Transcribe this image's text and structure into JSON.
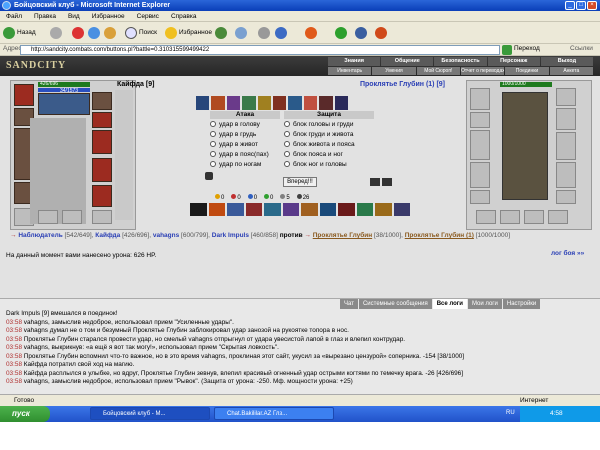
{
  "window": {
    "title": "Бойцовский клуб - Microsoft Internet Explorer"
  },
  "menu": [
    "Файл",
    "Правка",
    "Вид",
    "Избранное",
    "Сервис",
    "Справка"
  ],
  "toolbar": {
    "back": "Назад",
    "search": "Поиск",
    "favorites": "Избранное"
  },
  "address": {
    "label": "Адрес",
    "url": "http://sandcity.combats.com/buttons.pl?battle=0.310315599499422",
    "go": "Переход",
    "links": "Ссылки"
  },
  "site": {
    "logo": "SANDCITY",
    "nav": [
      "Знания",
      "Общение",
      "Безопасность",
      "Персонаж",
      "Выход"
    ],
    "subnav": [
      "Инвентарь",
      "Умения",
      "Мой Сюроп!",
      "Отчет о переводах",
      "Поединки",
      "Анкета"
    ]
  },
  "player": {
    "name": "Кайфда [9]",
    "hp": "426/696",
    "mp": "34/1573"
  },
  "opponent": {
    "name": "Проклятье Глубин (1) [9]",
    "hp": "1000/1000"
  },
  "attack": {
    "header": "Атака",
    "options": [
      "удар в голову",
      "удар в грудь",
      "удар в живот",
      "удар в пояс(пах)",
      "удар по ногам"
    ]
  },
  "defense": {
    "header": "Защита",
    "options": [
      "блок головы и груди",
      "блок груди и живота",
      "блок живота и пояса",
      "блок пояса и ног",
      "блок ног и головы"
    ]
  },
  "forward_button": "Вперед!!!",
  "stats": [
    "0",
    "0",
    "0",
    "0",
    "5",
    "26"
  ],
  "vs_line": {
    "observer": "Наблюдатель",
    "observer_hp": "[542/649],",
    "p1": "Кайфда",
    "p1_hp": "[426/696],",
    "p2": "vahagns",
    "p2_hp": "[600/799],",
    "p3": "Dark Impuls",
    "p3_hp": "[460/858]",
    "against": "против",
    "e1": "Проклятье Глубин",
    "e1_hp": "[38/1000],",
    "e2": "Проклятье Глубин (1)",
    "e2_hp": "[1000/1000]"
  },
  "damage_text": "На данный момент вами нанесено урона: 626 HP.",
  "battle_log_link": "лог боя »»",
  "chat_tabs": [
    "Чат",
    "Системные сообщения",
    "Все логи",
    "Мои логи",
    "Настройки"
  ],
  "chat": [
    {
      "time": "",
      "text": "Dark Impuls [9] вмешался в поединок!"
    },
    {
      "time": "03:58",
      "text": "vahagns, замыслив недоброе, использовал прием \"Усиленные удары\"."
    },
    {
      "time": "03:58",
      "text": "vahagns думал не о том и безумный Проклятье Глубин заблокировал удар занозой на рукоятке топора в нос."
    },
    {
      "time": "03:58",
      "text": "Проклятье Глубин старался провести удар, но смелый vahagns отпрыгнул от удара увесистой лапой в глаз и влепил контрудар."
    },
    {
      "time": "03:58",
      "text": "vahagns, выкрикнув: «а ещё я вот так могу!», использовал прием \"Скрытая ловкость\"."
    },
    {
      "time": "03:58",
      "text": "Проклятье Глубин вспомнил что-то важное, но в это время vahagns, проклиная этот сайт, укусил за «вырезано цензурой» соперника. -154 [38/1000]"
    },
    {
      "time": "03:58",
      "text": "Кайфда потратил свой ход на магию."
    },
    {
      "time": "03:58",
      "text": "Кайфда расплылся в улыбке, но вдруг, Проклятье Глубин зевнув, влепил красивый огненный удар острыми когтями по темечку врага. -26 [426/696]"
    },
    {
      "time": "03:58",
      "text": "vahagns, замыслив недоброе, использовал прием \"Рывок\". (Защита от урона: -250. Мф. мощности урона: +25)"
    }
  ],
  "status": {
    "left": "Готово",
    "right": "Интернет"
  },
  "taskbar": {
    "start": "пуск",
    "tasks": [
      "Бойцовский клуб - M...",
      "Chat.Bakililar.AZ Глз..."
    ],
    "lang": "RU",
    "clock": "4:58"
  }
}
